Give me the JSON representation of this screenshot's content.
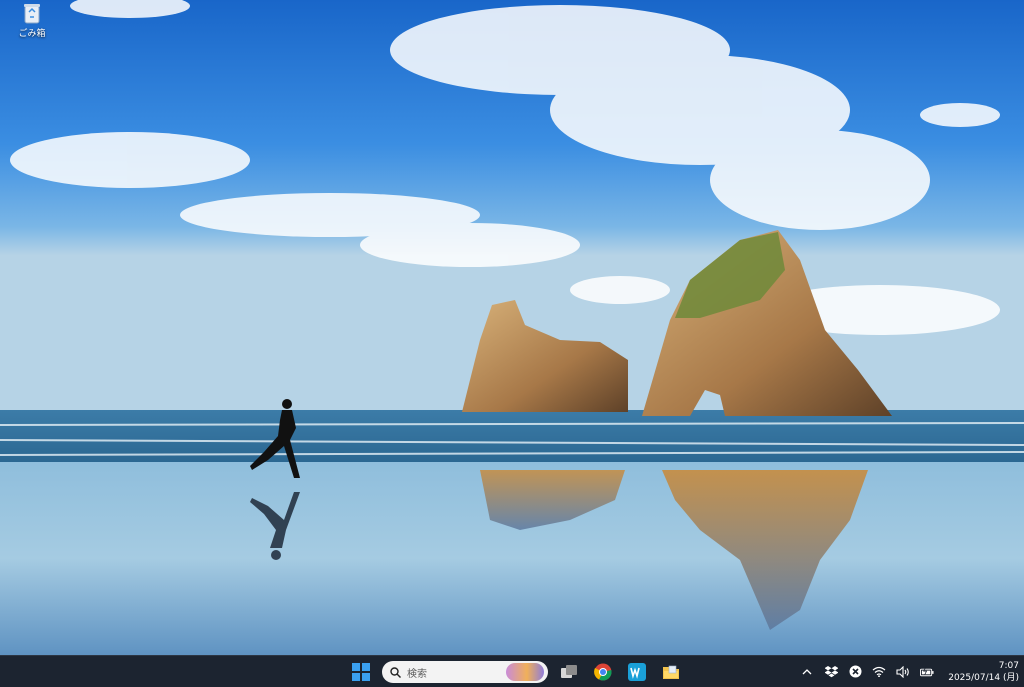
{
  "desktop": {
    "icons": [
      {
        "label": "ごみ箱",
        "icon": "recycle-bin-icon"
      }
    ]
  },
  "taskbar": {
    "start": {
      "icon": "windows-start-icon",
      "color": "#3aa0f0"
    },
    "search": {
      "placeholder": "検索",
      "icon": "search-icon"
    },
    "pinned": [
      {
        "name": "task-view",
        "icon": "task-view-icon"
      },
      {
        "name": "chrome",
        "icon": "chrome-icon"
      },
      {
        "name": "word",
        "icon": "word-icon",
        "color": "#1aa0d8"
      },
      {
        "name": "file-explorer",
        "icon": "folder-icon"
      }
    ],
    "tray": {
      "icons": [
        "chevron-up-icon",
        "dropbox-icon",
        "close-circle-icon",
        "wifi-icon",
        "volume-icon",
        "battery-icon"
      ],
      "time": "7:07",
      "date": "2025/07/14 (月)"
    }
  },
  "colors": {
    "taskbar_bg": "#1c2430",
    "accent": "#3aa0f0"
  }
}
